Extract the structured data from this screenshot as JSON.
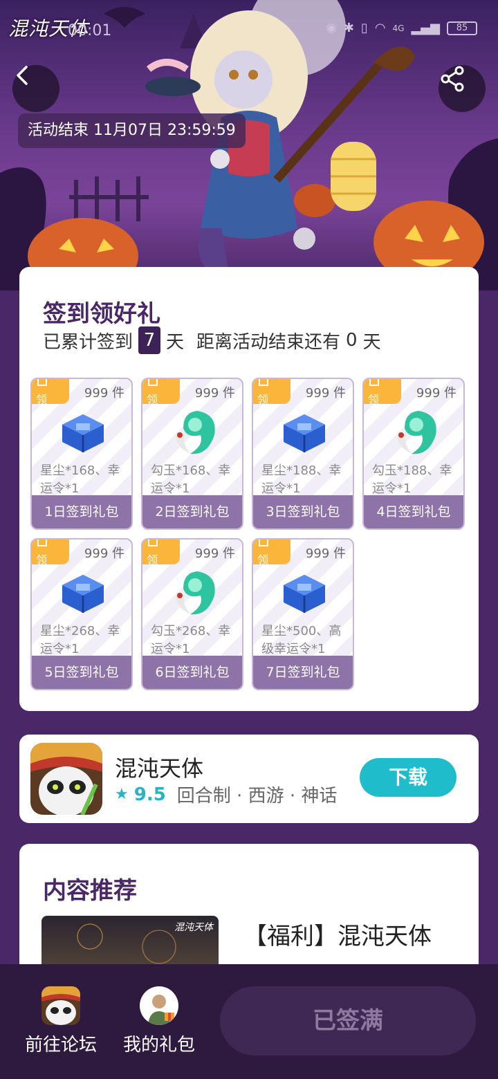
{
  "status_bar": {
    "logo": "混沌天体",
    "time": "00:01",
    "network": "4G",
    "battery": "85"
  },
  "hero": {
    "deadline": "活动结束 11月07日 23:59:59"
  },
  "signin": {
    "title": "签到领好礼",
    "summary_prefix": "已累计签到",
    "days_signed": "7",
    "summary_unit": "天",
    "remaining_prefix": "距离活动结束还有",
    "remaining_days": "0",
    "remaining_unit": "天",
    "gifts": [
      {
        "tag": "领",
        "count": "999 件",
        "desc": "星尘*168、幸运令*1",
        "label": "1日签到礼包",
        "icon": "stardust-chest-icon"
      },
      {
        "tag": "领",
        "count": "999 件",
        "desc": "勾玉*168、幸运令*1",
        "label": "2日签到礼包",
        "icon": "magatama-icon"
      },
      {
        "tag": "领",
        "count": "999 件",
        "desc": "星尘*188、幸运令*1",
        "label": "3日签到礼包",
        "icon": "stardust-chest-icon"
      },
      {
        "tag": "领",
        "count": "999 件",
        "desc": "勾玉*188、幸运令*1",
        "label": "4日签到礼包",
        "icon": "magatama-icon"
      },
      {
        "tag": "领",
        "count": "999 件",
        "desc": "星尘*268、幸运令*1",
        "label": "5日签到礼包",
        "icon": "stardust-chest-icon"
      },
      {
        "tag": "领",
        "count": "999 件",
        "desc": "勾玉*268、幸运令*1",
        "label": "6日签到礼包",
        "icon": "magatama-icon"
      },
      {
        "tag": "领",
        "count": "999 件",
        "desc": "星尘*500、高级幸运令*1",
        "label": "7日签到礼包",
        "icon": "stardust-chest-icon"
      }
    ]
  },
  "app": {
    "name": "混沌天体",
    "rating": "9.5",
    "tags": "回合制 · 西游 · 神话",
    "download_label": "下载"
  },
  "recommend": {
    "title": "内容推荐",
    "article_title": "【福利】混沌天体",
    "thumb_logo": "混沌天体"
  },
  "bottom": {
    "forum_label": "前往论坛",
    "gifts_label": "我的礼包",
    "signed_label": "已签满"
  },
  "colors": {
    "brand_purple": "#4a2766",
    "accent_teal": "#1fbccc",
    "tag_orange": "#fbb53a",
    "gift_label": "#8e73a8"
  }
}
